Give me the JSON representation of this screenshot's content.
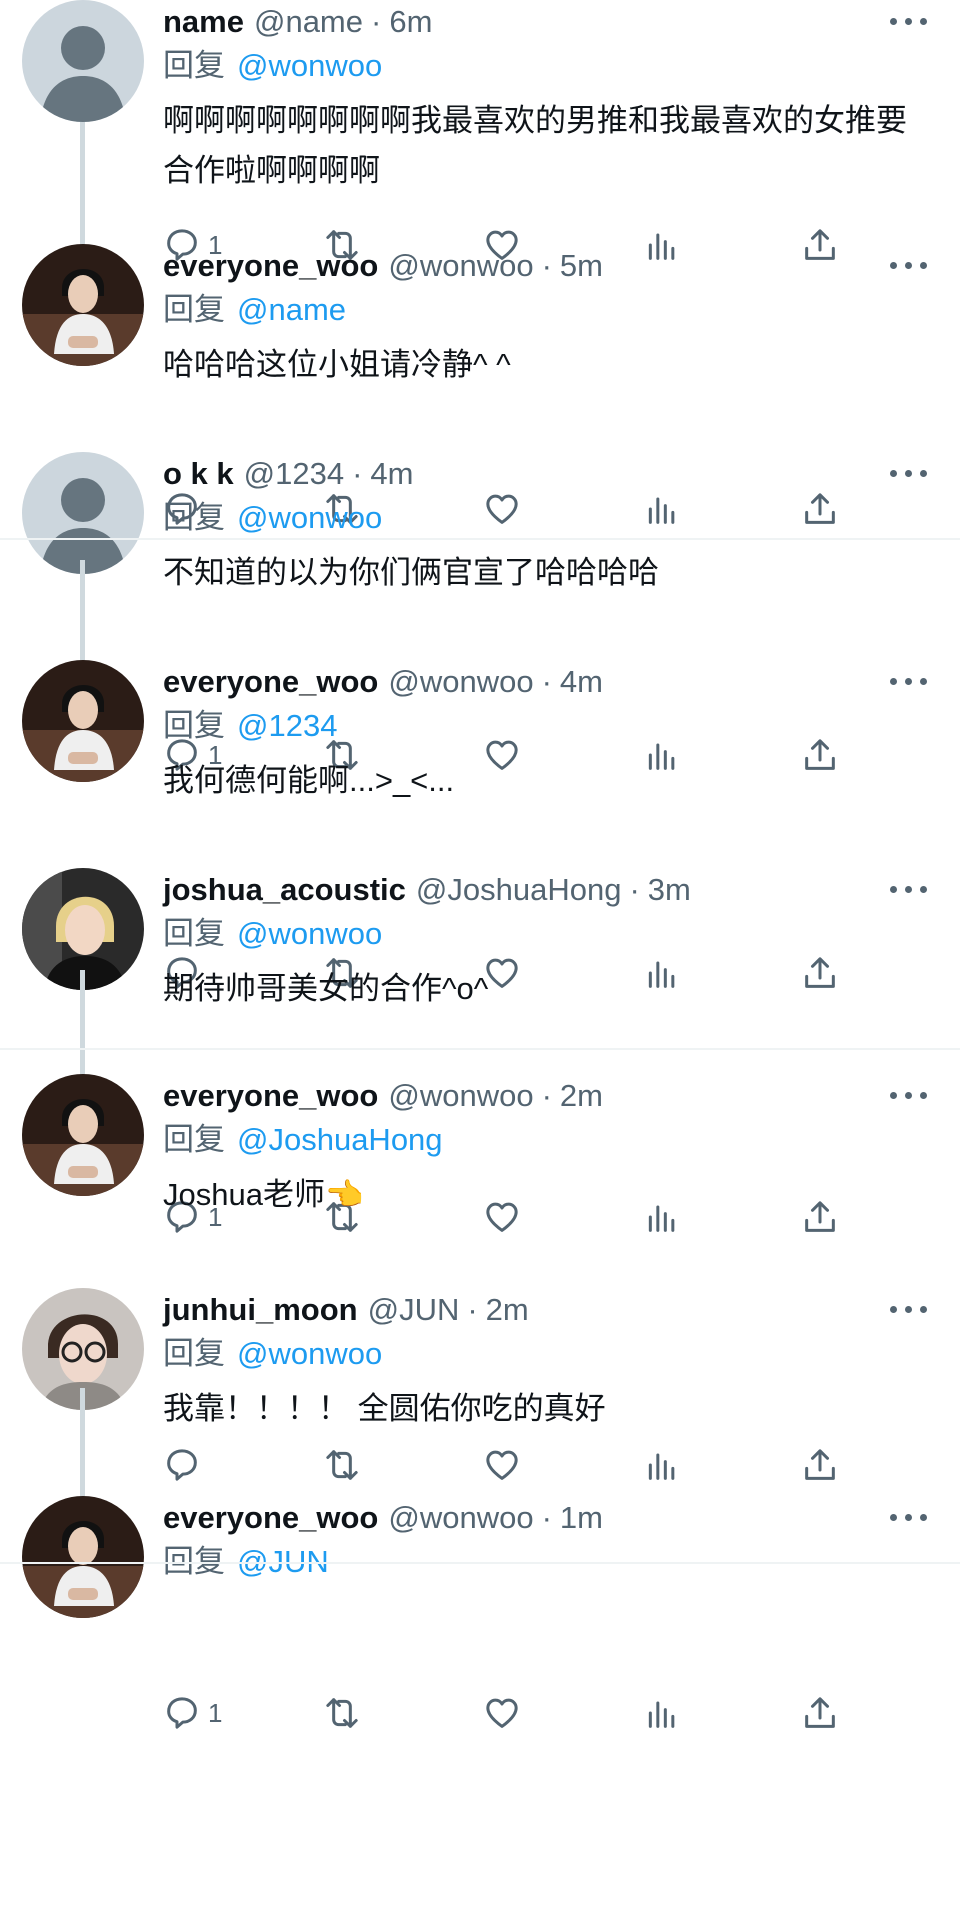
{
  "tweets": [
    {
      "name": "name",
      "handle": "@name",
      "time": "6m",
      "reply_label": "回复",
      "reply_to": "@wonwoo",
      "text": "啊啊啊啊啊啊啊啊我最喜欢的男推和我最喜欢的女推要合作啦啊啊啊啊",
      "reply_count": "1",
      "avatar": "default-avatar"
    },
    {
      "name": "everyone_woo",
      "handle": "@wonwoo",
      "time": "5m",
      "reply_label": "回复",
      "reply_to": "@name",
      "text": "哈哈哈这位小姐请冷静^ ^",
      "reply_count": "",
      "avatar": "photo-avatar-dark"
    },
    {
      "name": "o k k",
      "handle": "@1234",
      "time": "4m",
      "reply_label": "回复",
      "reply_to": "@wonwoo",
      "text": "不知道的以为你们俩官宣了哈哈哈哈",
      "reply_count": "1",
      "avatar": "default-avatar"
    },
    {
      "name": "everyone_woo",
      "handle": "@wonwoo",
      "time": "4m",
      "reply_label": "回复",
      "reply_to": "@1234",
      "text": "我何德何能啊...>_<...",
      "reply_count": "",
      "avatar": "photo-avatar-dark"
    },
    {
      "name": "joshua_acoustic",
      "handle": "@JoshuaHong",
      "time": "3m",
      "reply_label": "回复",
      "reply_to": "@wonwoo",
      "text": "期待帅哥美女的合作^o^",
      "reply_count": "1",
      "avatar": "photo-avatar-blond"
    },
    {
      "name": "everyone_woo",
      "handle": "@wonwoo",
      "time": "2m",
      "reply_label": "回复",
      "reply_to": "@JoshuaHong",
      "text": "Joshua老师👈",
      "reply_count": "",
      "avatar": "photo-avatar-dark"
    },
    {
      "name": "junhui_moon",
      "handle": "@JUN",
      "time": "2m",
      "reply_label": "回复",
      "reply_to": "@wonwoo",
      "text": "我靠！！！！ 全圆佑你吃的真好",
      "reply_count": "1",
      "avatar": "photo-avatar-glasses"
    },
    {
      "name": "everyone_woo",
      "handle": "@wonwoo",
      "time": "1m",
      "reply_label": "回复",
      "reply_to": "@JUN",
      "text": "",
      "reply_count": "",
      "avatar": "photo-avatar-dark"
    }
  ],
  "dot": "·",
  "icons": [
    "reply-icon",
    "retweet-icon",
    "like-icon",
    "views-icon",
    "share-icon",
    "more-icon"
  ],
  "colors": {
    "link": "#1d9bf0",
    "muted": "#536471",
    "text": "#0f1419",
    "divider": "#eff3f4",
    "thread_line": "#cfd9de"
  }
}
